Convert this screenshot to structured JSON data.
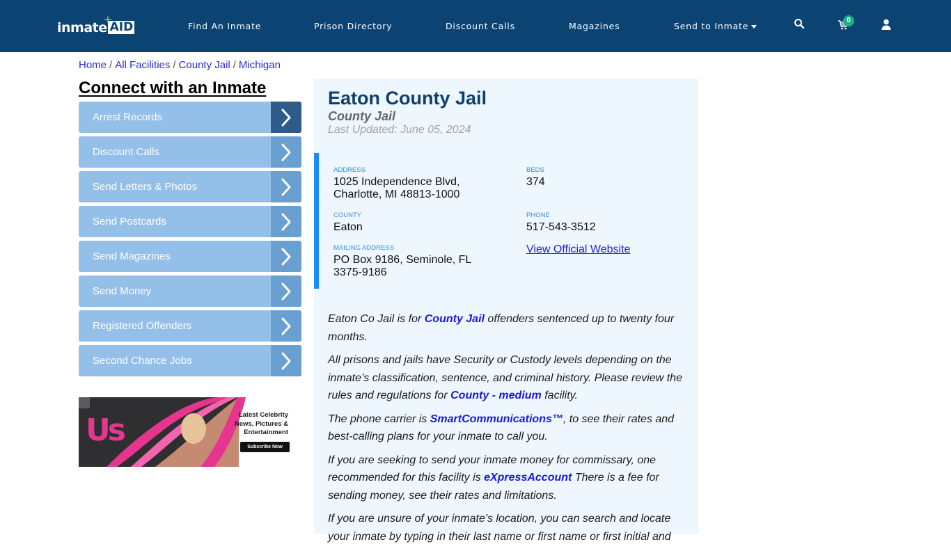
{
  "header": {
    "logo": {
      "part1": "inmate",
      "part2": "AID",
      "plus": "+"
    },
    "nav": [
      {
        "label": "Find An Inmate"
      },
      {
        "label": "Prison Directory"
      },
      {
        "label": "Discount Calls"
      },
      {
        "label": "Magazines"
      },
      {
        "label": "Send to Inmate",
        "has_dropdown": true
      }
    ],
    "icons": {
      "search": "search-icon",
      "cart": "cart-icon",
      "user": "user-icon"
    },
    "cart_count": "0"
  },
  "breadcrumb": [
    {
      "label": "Home"
    },
    {
      "label": "All Facilities"
    },
    {
      "label": "County Jail"
    },
    {
      "label": "Michigan"
    }
  ],
  "breadcrumb_separator": "/",
  "sidebar": {
    "title": "Connect with an Inmate",
    "items": [
      {
        "label": "Arrest Records",
        "active": true
      },
      {
        "label": "Discount Calls"
      },
      {
        "label": "Send Letters & Photos"
      },
      {
        "label": "Send Postcards"
      },
      {
        "label": "Send Magazines"
      },
      {
        "label": "Send Money"
      },
      {
        "label": "Registered Offenders"
      },
      {
        "label": "Second Chance Jobs"
      }
    ],
    "ad": {
      "brand": "Us",
      "headline_lines": [
        "Latest Celebrity",
        "News, Pictures &",
        "Entertainment"
      ],
      "button": "Subscribe Now"
    }
  },
  "facility": {
    "name": "Eaton County Jail",
    "type": "County Jail",
    "last_updated": "Last Updated: June 05, 2024",
    "fields": {
      "address_label": "ADDRESS",
      "address_line1": "1025 Independence Blvd,",
      "address_line2": "Charlotte, MI 48813-1000",
      "beds_label": "BEDS",
      "beds": "374",
      "county_label": "COUNTY",
      "county": "Eaton",
      "phone_label": "PHONE",
      "phone": "517-543-3512",
      "mailing_label": "MAILING ADDRESS",
      "mailing_line1": "PO Box 9186, Seminole, FL",
      "mailing_line2": "3375-9186",
      "website_link": "View Official Website"
    },
    "description": [
      {
        "before": "Eaton Co Jail is for ",
        "link": "County Jail",
        "after": " offenders sentenced up to twenty four months."
      },
      {
        "before": "All prisons and jails have Security or Custody levels depending on the inmate’s classification, sentence, and criminal history. Please review the rules and regulations for ",
        "link": "County - medium",
        "after": " facility."
      },
      {
        "before": "The phone carrier is ",
        "link": "SmartCommunications™",
        "after": ", to see their rates and best-calling plans for your inmate to call you."
      },
      {
        "before": "If you are seeking to send your inmate money for commissary, one recommended for this facility is ",
        "link": "eXpressAccount",
        "after": " There is a fee for sending money, see their rates and limitations."
      },
      {
        "before": "If you are unsure of your inmate's location, you can search and locate your inmate by typing in their last name or first name or first initial and ",
        "link": "",
        "after": ""
      }
    ]
  },
  "colors": {
    "header_bg": "#0b4373",
    "sidebar_item_bg": "#94bfe8",
    "sidebar_arrow_bg": "#6a9fd2",
    "sidebar_arrow_active_bg": "#2d5b8a",
    "panel_bg": "#eef7fd",
    "accent_bar": "#1a8cff",
    "title_color": "#0e3f6e",
    "link_color": "#1a1adb",
    "badge_color": "#1fae8b"
  }
}
